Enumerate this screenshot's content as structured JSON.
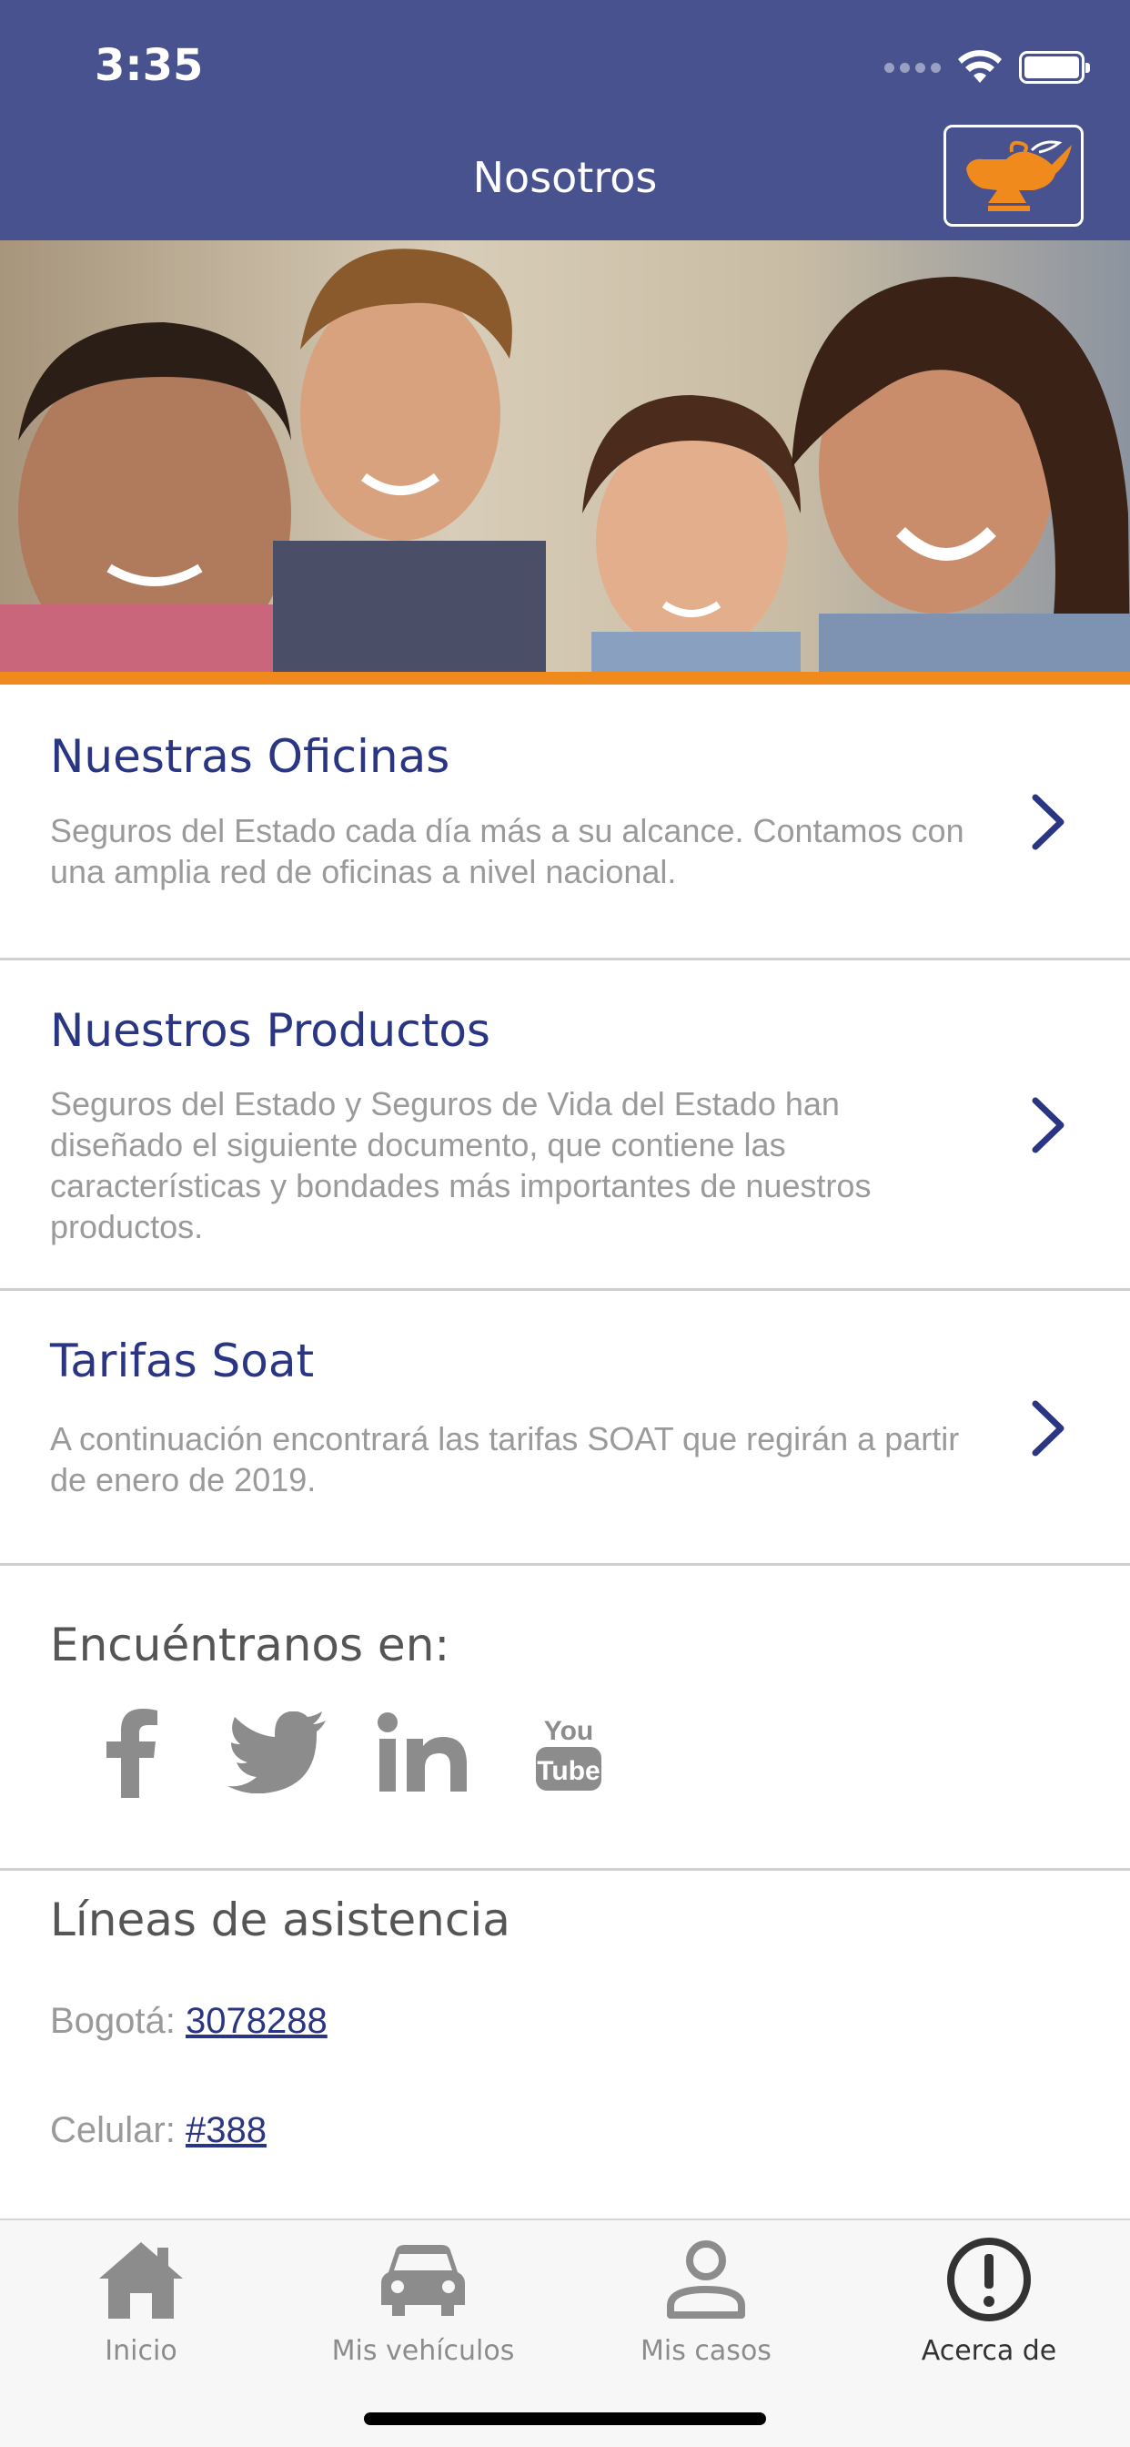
{
  "status_bar": {
    "time": "3:35"
  },
  "header": {
    "title": "Nosotros",
    "logo_icon": "magic-lamp-icon"
  },
  "hero": {
    "image": "family-photo"
  },
  "menu": [
    {
      "title": "Nuestras Oficinas",
      "description": "Seguros del Estado cada día más a su alcance. Contamos con una amplia red de oficinas a nivel nacional."
    },
    {
      "title": "Nuestros Productos",
      "description": "Seguros del Estado y Seguros de Vida del Estado han diseñado el siguiente documento, que contiene las características y bondades más importantes de nuestros productos."
    },
    {
      "title": "Tarifas Soat",
      "description": "A continuación encontrará las tarifas SOAT que regirán a partir de enero de 2019."
    }
  ],
  "social": {
    "title": "Encuéntranos en:",
    "icons": [
      "facebook-icon",
      "twitter-icon",
      "linkedin-icon",
      "youtube-icon"
    ]
  },
  "assistance": {
    "title": "Líneas de asistencia",
    "lines": [
      {
        "label": "Bogotá:",
        "number": "3078288"
      },
      {
        "label": "Celular:",
        "number": "#388"
      }
    ]
  },
  "tabs": [
    {
      "label": "Inicio",
      "icon": "home-icon"
    },
    {
      "label": "Mis vehículos",
      "icon": "car-icon"
    },
    {
      "label": "Mis casos",
      "icon": "person-icon"
    },
    {
      "label": "Acerca de",
      "icon": "info-icon",
      "active": true
    }
  ],
  "colors": {
    "header": "#47528f",
    "accent": "#f08a1c",
    "title": "#2a3583",
    "text_muted": "#9a9a9a"
  }
}
